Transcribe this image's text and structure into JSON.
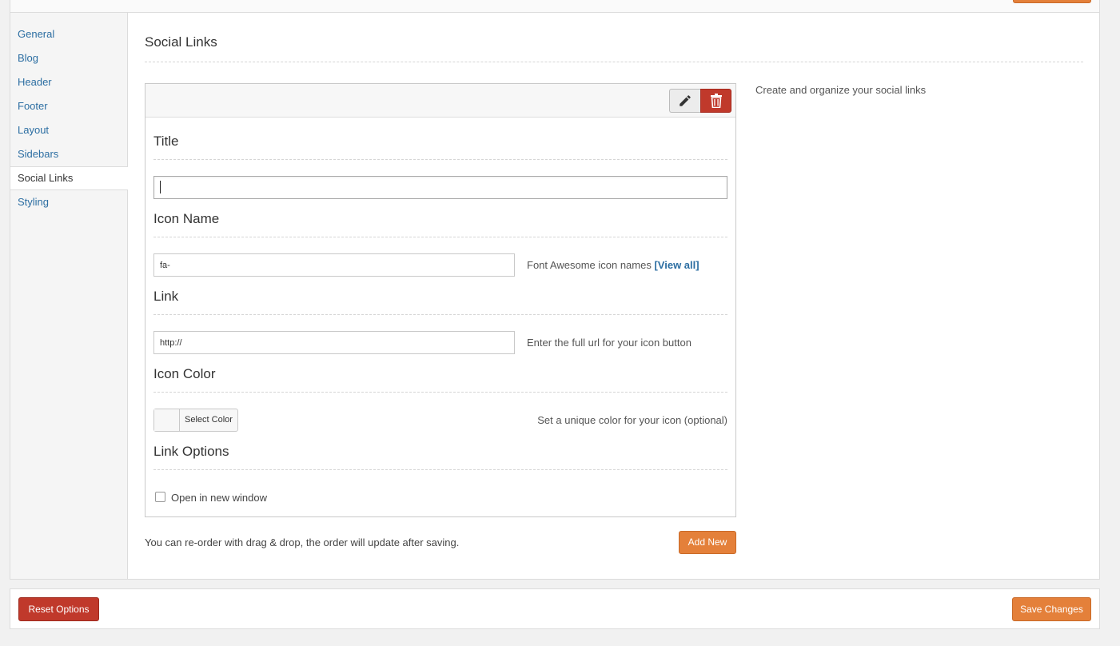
{
  "sidebar": {
    "items": [
      {
        "label": "General"
      },
      {
        "label": "Blog"
      },
      {
        "label": "Header"
      },
      {
        "label": "Footer"
      },
      {
        "label": "Layout"
      },
      {
        "label": "Sidebars"
      },
      {
        "label": "Social Links",
        "active": true
      },
      {
        "label": "Styling"
      }
    ]
  },
  "main": {
    "title": "Social Links",
    "description": "Create and organize your social links",
    "fields": {
      "title": {
        "label": "Title",
        "value": ""
      },
      "icon_name": {
        "label": "Icon Name",
        "value": "fa-",
        "hint": "Font Awesome icon names",
        "hint_link": "[View all]"
      },
      "link": {
        "label": "Link",
        "value": "http://",
        "hint": "Enter the full url for your icon button"
      },
      "icon_color": {
        "label": "Icon Color",
        "button": "Select Color",
        "hint": "Set a unique color for your icon (optional)"
      },
      "link_options": {
        "label": "Link Options",
        "checkbox_label": "Open in new window",
        "checked": false
      }
    },
    "footnote": "You can re-order with drag & drop, the order will update after saving.",
    "add_new": "Add New"
  },
  "footer": {
    "reset": "Reset Options",
    "save": "Save Changes"
  },
  "colors": {
    "accent": "#e4803a",
    "danger": "#c0392b",
    "link": "#2c6ea2"
  },
  "icons": {
    "edit": "pencil-icon",
    "delete": "trash-icon"
  }
}
